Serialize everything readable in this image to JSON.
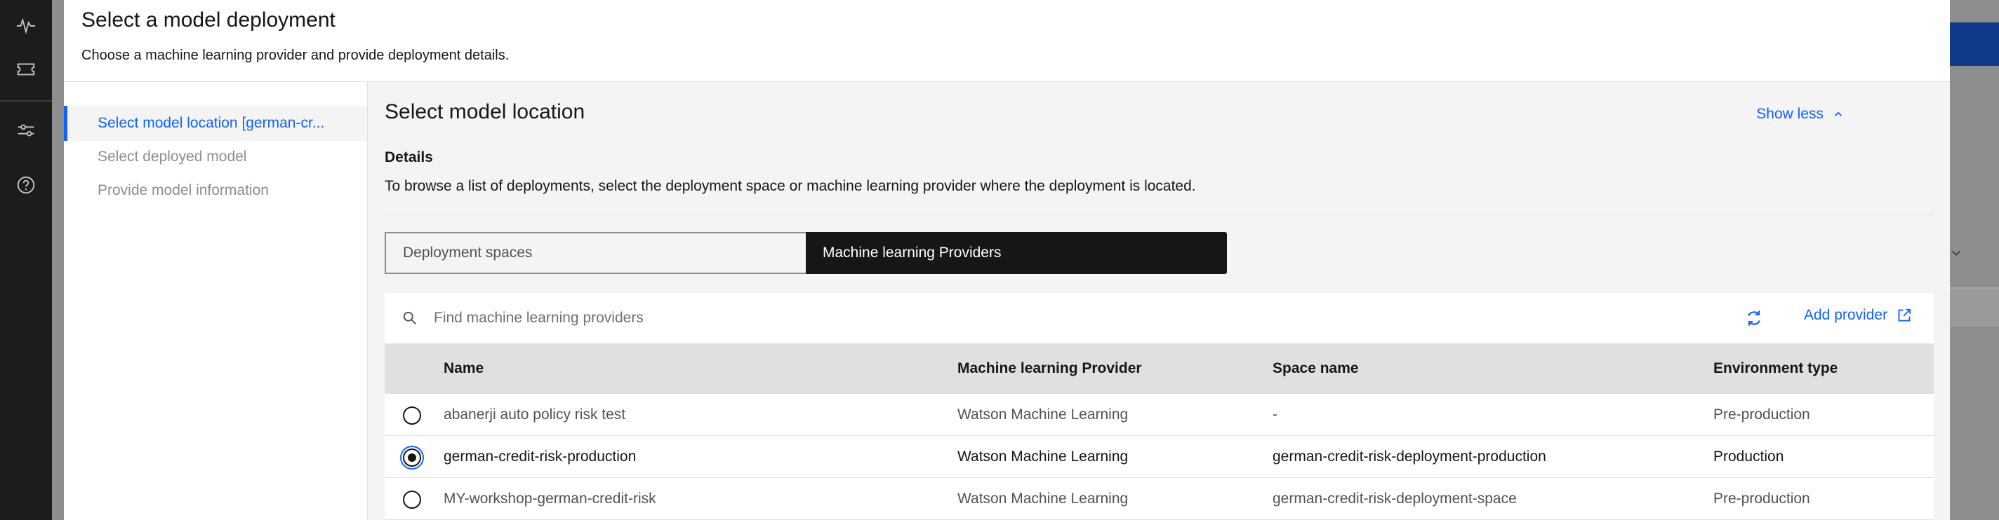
{
  "modal": {
    "title": "Select a model deployment",
    "subtitle": "Choose a machine learning provider and provide deployment details."
  },
  "steps": [
    {
      "label": "Select model location [german-cr..."
    },
    {
      "label": "Select deployed model"
    },
    {
      "label": "Provide model information"
    }
  ],
  "section": {
    "title": "Select model location",
    "show_less": "Show less",
    "details_heading": "Details",
    "details_text": "To browse a list of deployments, select the deployment space or machine learning provider where the deployment is located."
  },
  "switcher": {
    "option1": "Deployment spaces",
    "option2": "Machine learning Providers",
    "selected": "Machine learning Providers"
  },
  "toolbar": {
    "search_placeholder": "Find machine learning providers",
    "add_provider": "Add provider"
  },
  "table": {
    "headers": {
      "name": "Name",
      "provider": "Machine learning Provider",
      "space": "Space name",
      "env": "Environment type"
    },
    "rows": [
      {
        "name": "abanerji auto policy risk test",
        "provider": "Watson Machine Learning",
        "space": "-",
        "env": "Pre-production",
        "selected": false
      },
      {
        "name": "german-credit-risk-production",
        "provider": "Watson Machine Learning",
        "space": "german-credit-risk-deployment-production",
        "env": "Production",
        "selected": true
      },
      {
        "name": "MY-workshop-german-credit-risk",
        "provider": "Watson Machine Learning",
        "space": "german-credit-risk-deployment-space",
        "env": "Pre-production",
        "selected": false
      }
    ]
  },
  "colors": {
    "accent": "#0f62fe",
    "rail": "#1c1c1c",
    "selected_tab": "#161616"
  },
  "icons": [
    "activity-icon",
    "ticket-icon",
    "sliders-icon",
    "help-icon",
    "chevron-up-icon",
    "search-icon",
    "refresh-icon",
    "launch-icon"
  ]
}
